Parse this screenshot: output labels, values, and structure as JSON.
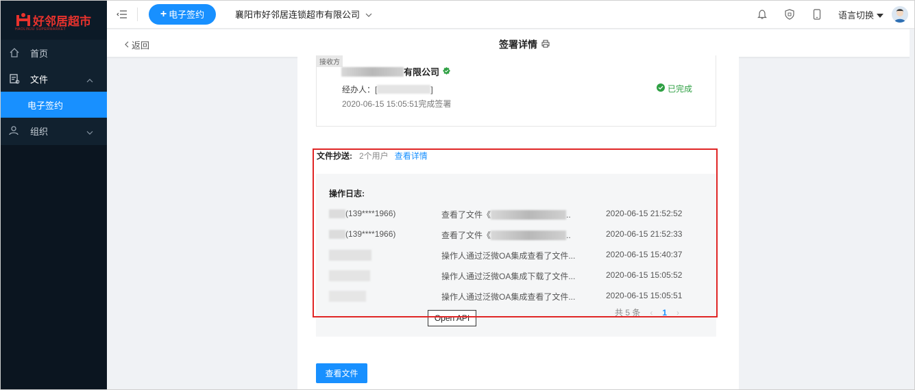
{
  "brand": {
    "logo_text": "好邻居超市",
    "logo_sub": "HAOLINJU SUPERMARKET",
    "accent_color": "#1890ff",
    "sidebar_color": "#11212f",
    "brand_red": "#e8322d"
  },
  "sidebar": {
    "items": [
      {
        "label": "首页",
        "icon": "home-icon"
      },
      {
        "label": "文件",
        "icon": "file-icon"
      },
      {
        "label": "电子签约"
      },
      {
        "label": "组织",
        "icon": "org-icon"
      }
    ]
  },
  "topbar": {
    "new_button": "电子签约",
    "company": "襄阳市好邻居连锁超市有限公司",
    "language": "语言切换",
    "icons": [
      "bell-icon",
      "shield-icon",
      "mobile-icon",
      "avatar"
    ]
  },
  "subbar": {
    "back": "返回",
    "title": "签署详情"
  },
  "receiver": {
    "tag": "接收方",
    "company_suffix": "有限公司",
    "agent_label": "经办人：[",
    "agent_close": "]",
    "signed_time": "2020-06-15 15:05:51完成签署",
    "status": "已完成",
    "status_color": "#2ea043"
  },
  "cc": {
    "label": "文件抄送:",
    "count": "2个用户",
    "link": "查看详情"
  },
  "log": {
    "title": "操作日志:",
    "rows": [
      {
        "user": "(139****1966)",
        "action": "查看了文件《",
        "action_tail": "..",
        "time": "2020-06-15 21:52:52"
      },
      {
        "user": "(139****1966)",
        "action": "查看了文件《",
        "action_tail": "..",
        "time": "2020-06-15 21:52:33"
      },
      {
        "user": "",
        "action": "操作人通过泛微OA集成查看了文件...",
        "action_tail": "",
        "time": "2020-06-15 15:40:37"
      },
      {
        "user": "",
        "action": "操作人通过泛微OA集成下载了文件...",
        "action_tail": "",
        "time": "2020-06-15 15:05:52"
      },
      {
        "user": "",
        "action": "操作人通过泛微OA集成查看了文件...",
        "action_tail": "",
        "time": "2020-06-15 15:05:51"
      }
    ],
    "pager_total": "共 5 条",
    "pager_current": "1"
  },
  "annotation": {
    "label": "Open API",
    "highlight_color": "#e02424"
  },
  "actions": {
    "view_file": "查看文件"
  }
}
